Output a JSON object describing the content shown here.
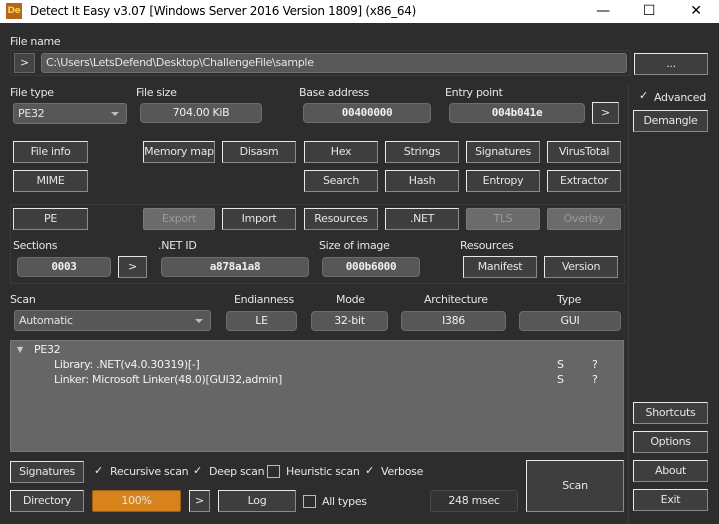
{
  "window": {
    "title": "Detect It Easy v3.07 [Windows Server 2016 Version 1809] (x86_64)",
    "logo": "De",
    "minimize": "—",
    "maximize": "☐",
    "close": "✕"
  },
  "file": {
    "label": "File name",
    "path": "C:\\Users\\LetsDefend\\Desktop\\ChallengeFile\\sample",
    "browse": "...",
    "open": ">"
  },
  "info": {
    "file_type_label": "File type",
    "file_type": "PE32",
    "file_size_label": "File size",
    "file_size": "704.00 KiB",
    "base_address_label": "Base address",
    "base_address": "00400000",
    "entry_point_label": "Entry point",
    "entry_point": "004b041e",
    "entry_go": ">"
  },
  "advanced": {
    "label": "Advanced",
    "checked": true,
    "demangle": "Demangle"
  },
  "tools": {
    "file_info": "File info",
    "memory_map": "Memory map",
    "disasm": "Disasm",
    "hex": "Hex",
    "strings": "Strings",
    "signatures": "Signatures",
    "virustotal": "VirusTotal",
    "mime": "MIME",
    "search": "Search",
    "hash": "Hash",
    "entropy": "Entropy",
    "extractor": "Extractor"
  },
  "pe": {
    "pe": "PE",
    "export": "Export",
    "import": "Import",
    "resources": "Resources",
    "net": ".NET",
    "tls": "TLS",
    "overlay": "Overlay",
    "sections_label": "Sections",
    "sections": "0003",
    "sections_go": ">",
    "net_id_label": ".NET ID",
    "net_id": "a878a1a8",
    "size_of_image_label": "Size of image",
    "size_of_image": "000b6000",
    "resources_label": "Resources",
    "manifest": "Manifest",
    "version": "Version"
  },
  "scan": {
    "label": "Scan",
    "mode_value": "Automatic",
    "endianness_label": "Endianness",
    "endianness": "LE",
    "mode_label": "Mode",
    "mode": "32-bit",
    "architecture_label": "Architecture",
    "architecture": "I386",
    "type_label": "Type",
    "type": "GUI"
  },
  "results": {
    "root": "PE32",
    "items": [
      {
        "text": "Library: .NET(v4.0.30319)[-]",
        "s": "S",
        "q": "?"
      },
      {
        "text": "Linker: Microsoft Linker(48.0)[GUI32,admin]",
        "s": "S",
        "q": "?"
      }
    ]
  },
  "side": {
    "shortcuts": "Shortcuts",
    "options": "Options",
    "about": "About",
    "exit": "Exit"
  },
  "bottom": {
    "signatures": "Signatures",
    "recursive": "Recursive scan",
    "deep": "Deep scan",
    "heuristic": "Heuristic scan",
    "verbose": "Verbose",
    "directory": "Directory",
    "progress": "100%",
    "progress_value": 100,
    "go": ">",
    "log": "Log",
    "all_types": "All types",
    "time": "248 msec",
    "scan": "Scan",
    "check": "✓"
  },
  "colors": {
    "progress": "#d8821c"
  }
}
